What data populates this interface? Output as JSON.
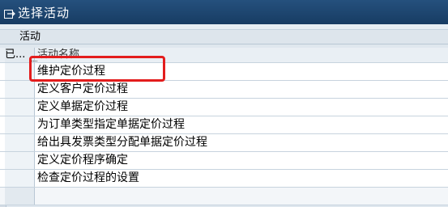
{
  "window": {
    "title": "选择活动"
  },
  "group": {
    "title": "活动"
  },
  "table": {
    "col_done": "已...",
    "col_name": "活动名称",
    "rows": [
      {
        "name": "维护定价过程"
      },
      {
        "name": "定义客户定价过程"
      },
      {
        "name": "定义单据定价过程"
      },
      {
        "name": "为订单类型指定单据定价过程"
      },
      {
        "name": "给出具发票类型分配单据定价过程"
      },
      {
        "name": "定义定价程序确定"
      },
      {
        "name": "检查定价过程的设置"
      }
    ]
  },
  "colors": {
    "title_bar": "#1f4a76",
    "highlight": "#e31d1d"
  }
}
